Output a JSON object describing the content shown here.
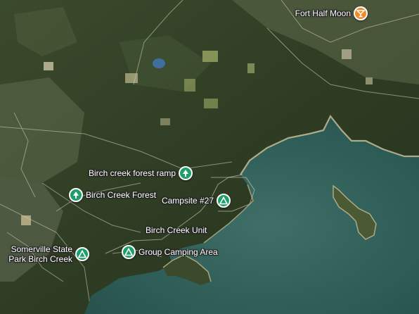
{
  "map": {
    "view": "satellite",
    "colors": {
      "park_marker": "#1e9e6a",
      "poi_marker": "#f08a2a",
      "water": "#2f5e58",
      "forest": "#2f3f25"
    },
    "places": [
      {
        "id": "fort-half-moon",
        "label": "Fort Half Moon",
        "icon": "bar-icon",
        "category": "poi"
      },
      {
        "id": "birch-creek-forest-ramp",
        "label": "Birch creek forest ramp",
        "icon": "tree-icon",
        "category": "park"
      },
      {
        "id": "birch-creek-forest",
        "label": "Birch Creek Forest",
        "icon": "tree-icon",
        "category": "park"
      },
      {
        "id": "campsite-27",
        "label": "Campsite #27",
        "icon": "tent-icon",
        "category": "park"
      },
      {
        "id": "somerville-state-park-birch-creek",
        "label": "Somerville State Park Birch Creek",
        "label_lines": [
          "Somerville State",
          "Park Birch Creek"
        ],
        "icon": "tent-icon",
        "category": "park"
      },
      {
        "id": "group-camping-area",
        "label": "Group Camping Area",
        "icon": "tent-icon",
        "category": "park"
      }
    ],
    "area_labels": [
      {
        "id": "birch-creek-unit",
        "label": "Birch Creek Unit"
      }
    ]
  }
}
